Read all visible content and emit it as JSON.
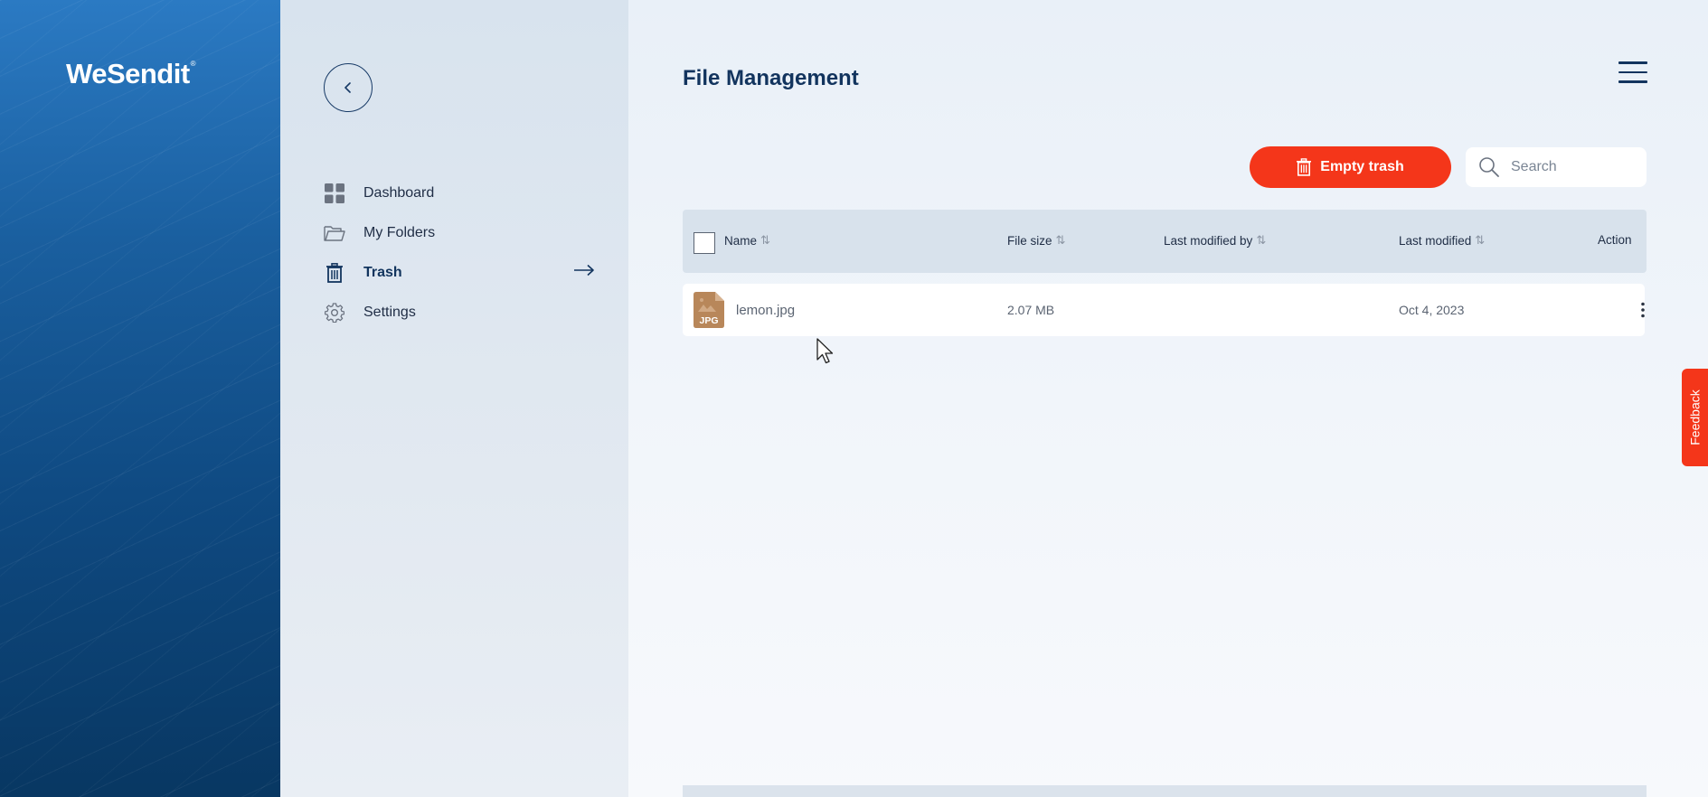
{
  "brand": {
    "name": "WeSendit",
    "mark": "®"
  },
  "nav": {
    "items": [
      {
        "label": "Dashboard",
        "icon": "grid-icon"
      },
      {
        "label": "My Folders",
        "icon": "folder-icon"
      },
      {
        "label": "Trash",
        "icon": "trash-icon",
        "active": true
      },
      {
        "label": "Settings",
        "icon": "gear-icon"
      }
    ]
  },
  "header": {
    "title": "File Management"
  },
  "toolbar": {
    "empty_trash_label": "Empty trash",
    "search_placeholder": "Search"
  },
  "table": {
    "columns": [
      "Name",
      "File size",
      "Last modified by",
      "Last modified",
      "Action"
    ],
    "rows": [
      {
        "file_type": "JPG",
        "name": "lemon.jpg",
        "size": "2.07 MB",
        "modified_by": "",
        "modified": "Oct 4, 2023"
      }
    ]
  },
  "feedback_label": "Feedback",
  "colors": {
    "accent": "#f4361a",
    "primary": "#12345e",
    "file_icon": "#b8875a"
  }
}
